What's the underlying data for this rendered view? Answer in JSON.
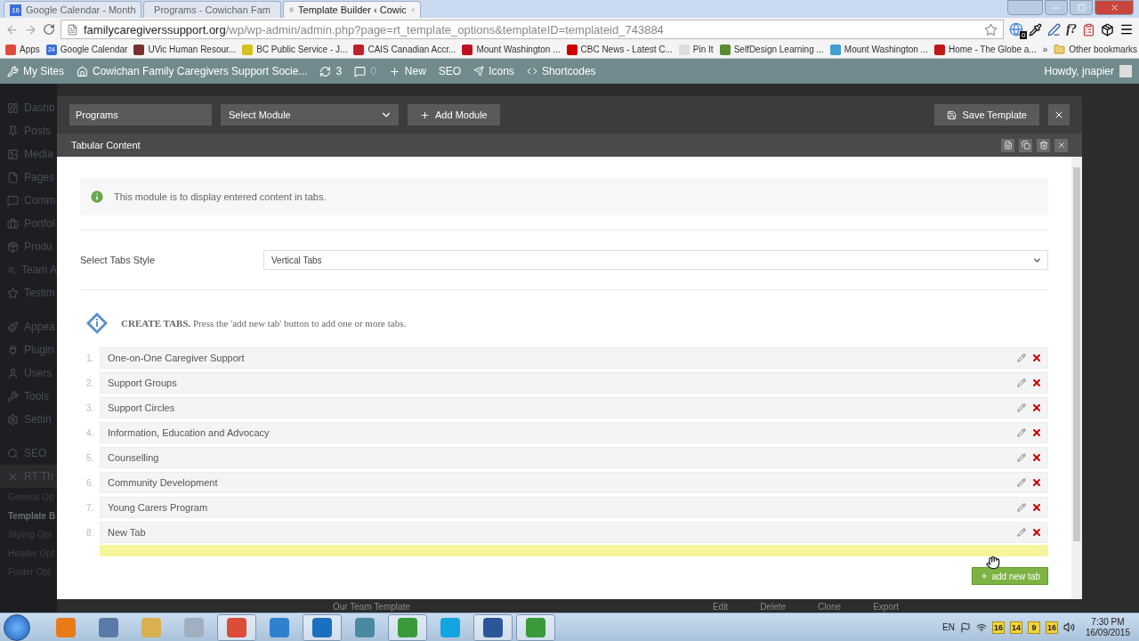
{
  "browser": {
    "tabs": [
      {
        "title": "Google Calendar - Month",
        "icon_text": "16",
        "selected": false
      },
      {
        "title": "Programs - Cowichan Fam",
        "selected": false
      },
      {
        "title": "Template Builder ‹ Cowic",
        "selected": true
      }
    ],
    "address": {
      "host": "familycaregiverssupport.org",
      "path": "/wp/wp-admin/admin.php?page=rt_template_options&templateID=templateid_743884"
    },
    "extension_badge": "0",
    "formula_extension": "f?",
    "bookmarks": [
      {
        "label": "Apps"
      },
      {
        "label": "Google Calendar",
        "icon_text": "24"
      },
      {
        "label": "UVic Human Resour..."
      },
      {
        "label": "BC Public Service - J..."
      },
      {
        "label": "CAIS Canadian Accr..."
      },
      {
        "label": "Mount Washington ..."
      },
      {
        "label": "CBC News - Latest C..."
      },
      {
        "label": "Pin It"
      },
      {
        "label": "SelfDesign Learning ..."
      },
      {
        "label": "Mount Washington ..."
      },
      {
        "label": "Home - The Globe a..."
      }
    ],
    "more_bookmarks": "»",
    "other_bookmarks": "Other bookmarks"
  },
  "admin_bar": {
    "my_sites": "My Sites",
    "site_name": "Cowichan Family Caregivers Support Socie...",
    "updates": "3",
    "comments": "0",
    "new": "New",
    "seo": "SEO",
    "icons": "Icons",
    "shortcodes": "Shortcodes",
    "greeting": "Howdy, jnapier"
  },
  "sidebar": {
    "items": [
      {
        "label": "Dashb",
        "selected": false
      },
      {
        "label": "Posts",
        "selected": false
      },
      {
        "label": "Media",
        "selected": false
      },
      {
        "label": "Pages",
        "selected": false
      },
      {
        "label": "Comm",
        "selected": false
      },
      {
        "label": "Portfol",
        "selected": false
      },
      {
        "label": "Produ",
        "selected": false
      },
      {
        "label": "Team A",
        "selected": false
      },
      {
        "label": "Testim",
        "selected": false
      },
      {
        "label": "Appea",
        "selected": false
      },
      {
        "label": "Plugin",
        "selected": false
      },
      {
        "label": "Users",
        "selected": false
      },
      {
        "label": "Tools",
        "selected": false
      },
      {
        "label": "Settin",
        "selected": false
      },
      {
        "label": "SEO",
        "selected": false
      },
      {
        "label": "RT Th",
        "selected": true
      }
    ],
    "submenu": [
      {
        "label": "General Op",
        "selected": false
      },
      {
        "label": "Template B",
        "selected": true
      },
      {
        "label": "Styling Opt",
        "selected": false
      },
      {
        "label": "Header Opt",
        "selected": false
      },
      {
        "label": "Footer Opt",
        "selected": false
      }
    ]
  },
  "page_behind": {
    "template_name": "Our Team Template",
    "actions": [
      "Edit",
      "Delete",
      "Clone",
      "Export"
    ]
  },
  "modal": {
    "template_title": "Programs",
    "module_select": "Select Module",
    "add_module": "Add Module",
    "save": "Save Template",
    "section_title": "Tabular Content",
    "info": "This module is to display entered content in tabs.",
    "style_label": "Select Tabs Style",
    "style_value": "Vertical Tabs",
    "create_note": "**CREATE TABS.** Press the 'add new tab' button to add one or more tabs.",
    "tabs": [
      {
        "number": "1.",
        "title": "One-on-One Caregiver Support"
      },
      {
        "number": "2.",
        "title": "Support Groups"
      },
      {
        "number": "3.",
        "title": "Support Circles"
      },
      {
        "number": "4.",
        "title": "Information, Education and Advocacy"
      },
      {
        "number": "5.",
        "title": "Counselling"
      },
      {
        "number": "6.",
        "title": "Community Development"
      },
      {
        "number": "7.",
        "title": "Young Carers Program"
      },
      {
        "number": "8.",
        "title": "New Tab"
      }
    ],
    "drop_placeholder": true,
    "add_tab": "add new tab"
  },
  "taskbar": {
    "apps": [
      {
        "running": false
      },
      {
        "running": false
      },
      {
        "running": false
      },
      {
        "running": false
      },
      {
        "running": true
      },
      {
        "running": false
      },
      {
        "running": true
      },
      {
        "running": false
      },
      {
        "running": true
      },
      {
        "running": false
      },
      {
        "running": true
      },
      {
        "running": true
      }
    ],
    "language": "EN",
    "tray_badges": [
      "16",
      "14",
      "9",
      "16"
    ],
    "time": "7:30 PM",
    "date": "16/09/2015"
  }
}
